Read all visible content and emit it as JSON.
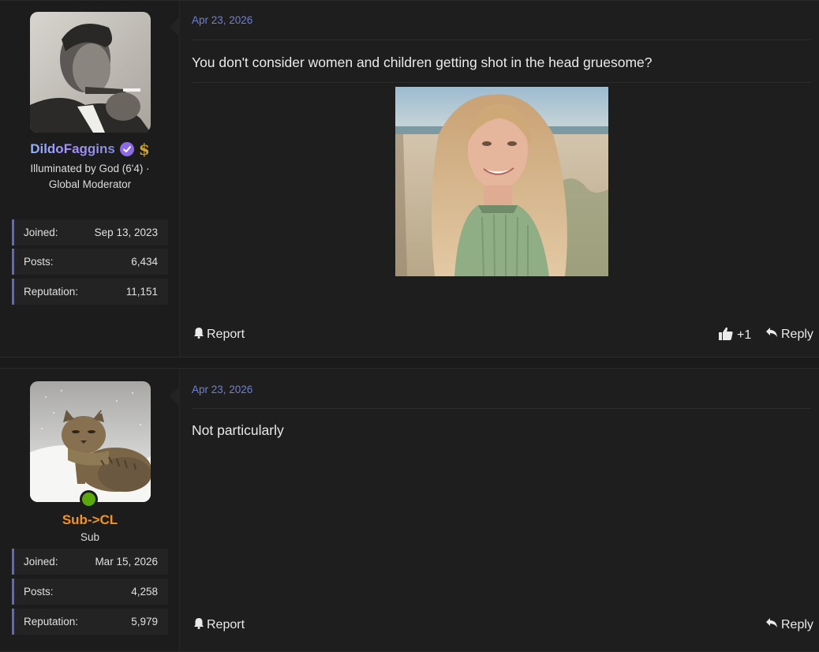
{
  "posts": [
    {
      "user": {
        "username": "DildoFaggins",
        "title": "Illuminated by God (6'4) · Global Moderator",
        "badges": [
          "verified-badge",
          "dollar-badge"
        ],
        "online": false,
        "stats": [
          {
            "label": "Joined:",
            "value": "Sep 13, 2023"
          },
          {
            "label": "Posts:",
            "value": "6,434"
          },
          {
            "label": "Reputation:",
            "value": "11,151"
          }
        ],
        "name_color": "#9fa8ff"
      },
      "date": "Apr 23, 2026",
      "message": "You don't consider women and children getting shot in the head gruesome?",
      "has_image": true,
      "actions": {
        "report": "Report",
        "reaction_count": "+1",
        "reply": "Reply"
      }
    },
    {
      "user": {
        "username": "Sub->CL",
        "title": "Sub",
        "online": true,
        "stats": [
          {
            "label": "Joined:",
            "value": "Mar 15, 2026"
          },
          {
            "label": "Posts:",
            "value": "4,258"
          },
          {
            "label": "Reputation:",
            "value": "5,979"
          }
        ],
        "name_color": "#f7931a"
      },
      "date": "Apr 23, 2026",
      "message": "Not particularly",
      "has_image": false,
      "actions": {
        "report": "Report",
        "reply": "Reply"
      }
    }
  ],
  "colors": {
    "accent": "#6f7fd1",
    "stat_border": "#5f68c2",
    "online": "#5aa80c"
  }
}
